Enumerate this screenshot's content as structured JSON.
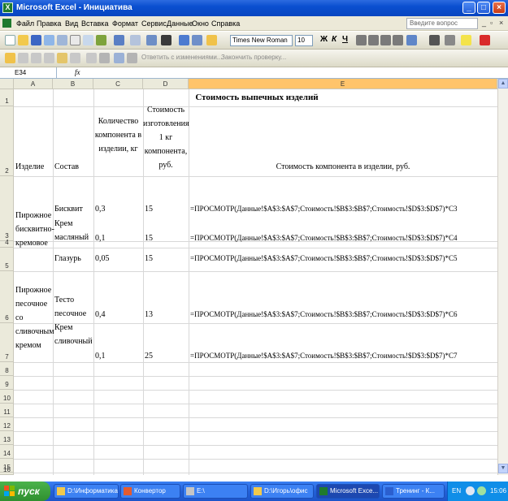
{
  "window": {
    "title": "Microsoft Excel - Инициатива"
  },
  "menu": {
    "items": [
      "Файл",
      "Правка",
      "Вид",
      "Вставка",
      "Формат",
      "Сервис",
      "Данные",
      "Окно",
      "Справка"
    ],
    "help_placeholder": "Введите вопрос"
  },
  "toolbar": {
    "font_name": "Times New Roman",
    "font_size": "10",
    "review_reply": "Ответить с изменениями...",
    "review_end": "Закончить проверку..."
  },
  "formula_bar": {
    "name_box": "E34",
    "fx": "fx",
    "content": ""
  },
  "grid": {
    "columns": [
      "A",
      "B",
      "C",
      "D",
      "E"
    ],
    "selected_column": "E",
    "rows": [
      "1",
      "2",
      "3",
      "4",
      "5",
      "6",
      "7",
      "8",
      "9",
      "10",
      "11",
      "12",
      "13",
      "14",
      "15",
      "16"
    ],
    "title": "Стоимость выпечных изделий",
    "headers": {
      "a": "Изделие",
      "b": "Состав",
      "c": "Количество компонента в изделии, кг",
      "d": "Стоимость изготовления 1 кг компонента, руб.",
      "e": "Стоимость компонента в изделии, руб."
    },
    "products": {
      "p1": "Пирожное бисквитно-кремовое",
      "p2": "Пирожное песочное со сливочным кремом"
    },
    "lines": [
      {
        "b": "Бисквит",
        "c": "0,3",
        "d": "15",
        "e": "=ПРОСМОТР(Данные!$A$3:$A$7;Стоимость!$B$3:$B$7;Стоимость!$D$3:$D$7)*C3"
      },
      {
        "b": "Крем масляный",
        "c": "0,1",
        "d": "15",
        "e": "=ПРОСМОТР(Данные!$A$3:$A$7;Стоимость!$B$3:$B$7;Стоимость!$D$3:$D$7)*C4"
      },
      {
        "b": "Глазурь",
        "c": "0,05",
        "d": "15",
        "e": "=ПРОСМОТР(Данные!$A$3:$A$7;Стоимость!$B$3:$B$7;Стоимость!$D$3:$D$7)*C5"
      },
      {
        "b": "Тесто песочное",
        "c": "0,4",
        "d": "13",
        "e": "=ПРОСМОТР(Данные!$A$3:$A$7;Стоимость!$B$3:$B$7;Стоимость!$D$3:$D$7)*C6"
      },
      {
        "b": "Крем сливочный",
        "c": "0,1",
        "d": "25",
        "e": "=ПРОСМОТР(Данные!$A$3:$A$7;Стоимость!$B$3:$B$7;Стоимость!$D$3:$D$7)*C7"
      }
    ]
  },
  "taskbar": {
    "start": "пуск",
    "tasks": [
      "D:\\Информатика",
      "Конвертор",
      "E:\\",
      "D:\\Игорь\\офис",
      "Microsoft Exce...",
      "Тренинг - К..."
    ],
    "lang": "EN",
    "clock": "15:06"
  }
}
